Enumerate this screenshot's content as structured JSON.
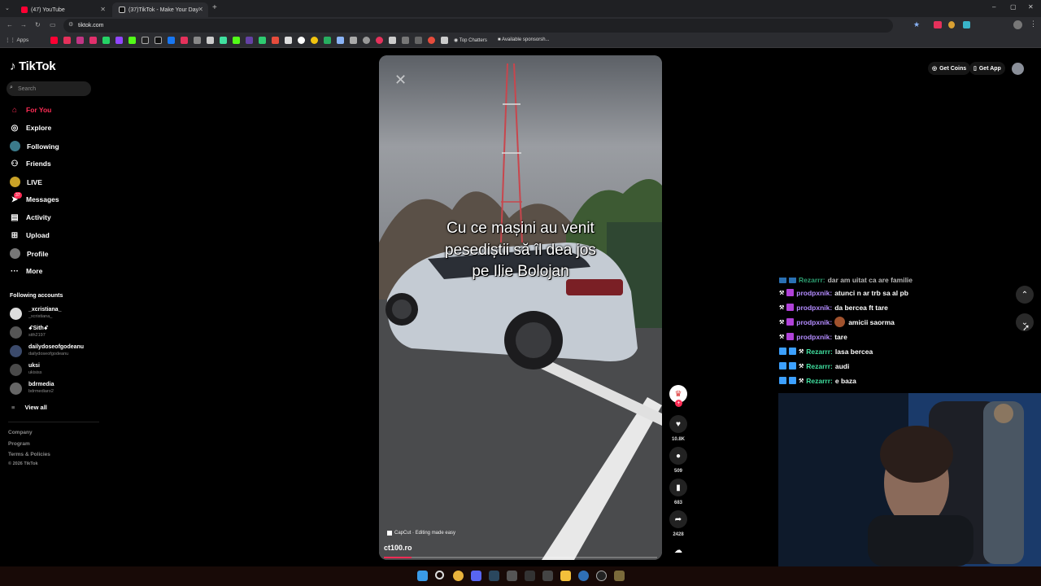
{
  "browser": {
    "tabs": [
      {
        "title": "(47) YouTube",
        "active": false
      },
      {
        "title": "(37)TikTok - Make Your Day",
        "active": true
      }
    ],
    "url": "tiktok.com",
    "bookmarks": {
      "apps_label": "Apps",
      "top_chatters": "Top Chatters",
      "sponsorships": "Available sponsorsh..."
    }
  },
  "tiktok": {
    "logo": "TikTok",
    "search_placeholder": "Search",
    "nav": [
      {
        "label": "For You",
        "icon": "home-icon",
        "active": true
      },
      {
        "label": "Explore",
        "icon": "compass-icon",
        "active": false
      },
      {
        "label": "Following",
        "icon": "following-icon",
        "active": false
      },
      {
        "label": "Friends",
        "icon": "friends-icon",
        "active": false
      },
      {
        "label": "LIVE",
        "icon": "live-icon",
        "active": false
      },
      {
        "label": "Messages",
        "icon": "messages-icon",
        "active": false,
        "badge": "37"
      },
      {
        "label": "Activity",
        "icon": "activity-icon",
        "active": false
      },
      {
        "label": "Upload",
        "icon": "upload-icon",
        "active": false
      },
      {
        "label": "Profile",
        "icon": "profile-icon",
        "active": false
      },
      {
        "label": "More",
        "icon": "more-icon",
        "active": false
      }
    ],
    "following_header": "Following accounts",
    "accounts": [
      {
        "name": "_xcristiana_",
        "handle": "_xcristiana_"
      },
      {
        "name": "ꗃSithꗃ",
        "handle": "sith2197"
      },
      {
        "name": "dailydoseofgodeanu",
        "handle": "dailydoseofgodeanu"
      },
      {
        "name": "uksi",
        "handle": "ukisiss"
      },
      {
        "name": "bdrmedia",
        "handle": "bdrmediaro2"
      }
    ],
    "view_all": "View all",
    "footer": [
      "Company",
      "Program",
      "Terms & Policies"
    ],
    "copyright": "© 2026 TikTok",
    "get_coins": "Get Coins",
    "get_app": "Get App"
  },
  "video": {
    "caption_lines": [
      "Cu ce mașini au venit",
      "pesediștii să îl dea jos",
      "pe Ilie Bolojan"
    ],
    "capcut": "CapCut · Editing made easy",
    "author": "ct100.ro",
    "progress": 0.1,
    "likes": "10.8K",
    "comments": "509",
    "saves": "683",
    "shares": "2428"
  },
  "chat": [
    {
      "user": "Rezarrr:",
      "msg": "dar am uitat ca are familie",
      "color": "r",
      "badges": 2
    },
    {
      "user": "prodpxnik:",
      "msg": "atunci n ar trb sa al pb",
      "color": "p",
      "badges": 1
    },
    {
      "user": "prodpxnik:",
      "msg": "da bercea ft tare",
      "color": "p",
      "badges": 1
    },
    {
      "user": "prodpxnik:",
      "msg": "amicii saorma",
      "color": "p",
      "badges": 1,
      "emote": true
    },
    {
      "user": "prodpxnik:",
      "msg": "tare",
      "color": "p",
      "badges": 1
    },
    {
      "user": "Rezarrr:",
      "msg": "lasa bercea",
      "color": "r",
      "badges": 2
    },
    {
      "user": "Rezarrr:",
      "msg": "audi",
      "color": "r",
      "badges": 2
    },
    {
      "user": "Rezarrr:",
      "msg": "e baza",
      "color": "r",
      "badges": 2
    }
  ],
  "colors": {
    "accent": "#fe2c55",
    "prod_user": "#b48cff",
    "rez_user": "#40e0a0"
  }
}
